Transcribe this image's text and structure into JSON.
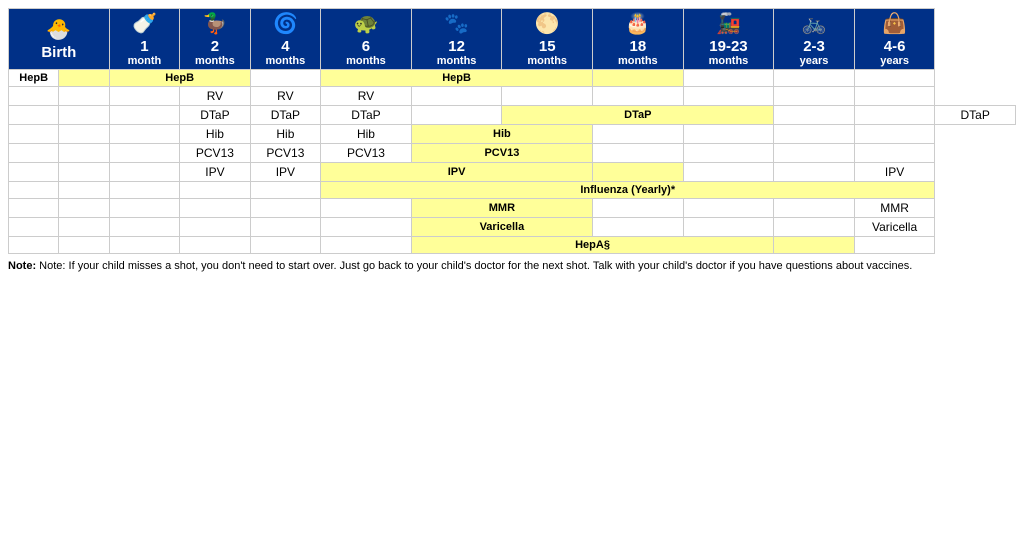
{
  "header": {
    "columns": [
      {
        "id": "birth",
        "icon": "🐣",
        "line1": "Birth",
        "line2": ""
      },
      {
        "id": "1m",
        "icon": "🍼",
        "line1": "1",
        "line2": "month"
      },
      {
        "id": "2m",
        "icon": "🦆",
        "line1": "2",
        "line2": "months"
      },
      {
        "id": "4m",
        "icon": "🌀",
        "line1": "4",
        "line2": "months"
      },
      {
        "id": "6m",
        "icon": "🐢",
        "line1": "6",
        "line2": "months"
      },
      {
        "id": "12m",
        "icon": "🐾",
        "line1": "12",
        "line2": "months"
      },
      {
        "id": "15m",
        "icon": "🌕",
        "line1": "15",
        "line2": "months"
      },
      {
        "id": "18m",
        "icon": "🎂",
        "line1": "18",
        "line2": "months"
      },
      {
        "id": "19m",
        "icon": "🚂",
        "line1": "19-23",
        "line2": "months"
      },
      {
        "id": "23y",
        "icon": "🚲",
        "line1": "2-3",
        "line2": "years"
      },
      {
        "id": "46y",
        "icon": "👜",
        "line1": "4-6",
        "line2": "years"
      }
    ]
  },
  "rows": [
    {
      "vaccine": "HepB",
      "cells": [
        {
          "id": "birth",
          "type": "yellow",
          "text": ""
        },
        {
          "id": "1m",
          "type": "yellow",
          "text": "HepB",
          "colspan": 2
        },
        {
          "id": "2m",
          "type": "skip"
        },
        {
          "id": "4m",
          "type": "empty",
          "text": ""
        },
        {
          "id": "6m",
          "type": "yellow",
          "text": "HepB",
          "colspan": 3
        },
        {
          "id": "12m",
          "type": "skip"
        },
        {
          "id": "15m",
          "type": "skip"
        },
        {
          "id": "18m",
          "type": "yellow",
          "text": ""
        },
        {
          "id": "19m",
          "type": "empty",
          "text": ""
        },
        {
          "id": "23y",
          "type": "empty",
          "text": ""
        },
        {
          "id": "46y",
          "type": "empty",
          "text": ""
        }
      ]
    },
    {
      "vaccine": "",
      "cells": [
        {
          "id": "birth",
          "type": "empty"
        },
        {
          "id": "1m",
          "type": "empty"
        },
        {
          "id": "2m",
          "type": "text",
          "text": "RV"
        },
        {
          "id": "4m",
          "type": "text",
          "text": "RV"
        },
        {
          "id": "6m",
          "type": "text",
          "text": "RV"
        },
        {
          "id": "12m",
          "type": "empty"
        },
        {
          "id": "15m",
          "type": "empty"
        },
        {
          "id": "18m",
          "type": "empty"
        },
        {
          "id": "19m",
          "type": "empty"
        },
        {
          "id": "23y",
          "type": "empty"
        },
        {
          "id": "46y",
          "type": "empty"
        }
      ]
    },
    {
      "vaccine": "",
      "cells": [
        {
          "id": "birth",
          "type": "empty"
        },
        {
          "id": "1m",
          "type": "empty"
        },
        {
          "id": "2m",
          "type": "text",
          "text": "DTaP"
        },
        {
          "id": "4m",
          "type": "text",
          "text": "DTaP"
        },
        {
          "id": "6m",
          "type": "text",
          "text": "DTaP"
        },
        {
          "id": "12m",
          "type": "empty"
        },
        {
          "id": "15m",
          "type": "yellow",
          "text": "DTaP",
          "colspan": 3
        },
        {
          "id": "18m",
          "type": "skip"
        },
        {
          "id": "19m",
          "type": "skip"
        },
        {
          "id": "23y",
          "type": "empty"
        },
        {
          "id": "46y",
          "type": "text",
          "text": "DTaP"
        }
      ]
    },
    {
      "vaccine": "",
      "cells": [
        {
          "id": "birth",
          "type": "empty"
        },
        {
          "id": "1m",
          "type": "empty"
        },
        {
          "id": "2m",
          "type": "text",
          "text": "Hib"
        },
        {
          "id": "4m",
          "type": "text",
          "text": "Hib"
        },
        {
          "id": "6m",
          "type": "text",
          "text": "Hib"
        },
        {
          "id": "12m",
          "type": "yellow",
          "text": "Hib",
          "colspan": 2
        },
        {
          "id": "15m",
          "type": "skip"
        },
        {
          "id": "18m",
          "type": "empty"
        },
        {
          "id": "19m",
          "type": "empty"
        },
        {
          "id": "23y",
          "type": "empty"
        },
        {
          "id": "46y",
          "type": "empty"
        }
      ]
    },
    {
      "vaccine": "",
      "cells": [
        {
          "id": "birth",
          "type": "empty"
        },
        {
          "id": "1m",
          "type": "empty"
        },
        {
          "id": "2m",
          "type": "text",
          "text": "PCV13"
        },
        {
          "id": "4m",
          "type": "text",
          "text": "PCV13"
        },
        {
          "id": "6m",
          "type": "text",
          "text": "PCV13"
        },
        {
          "id": "12m",
          "type": "yellow",
          "text": "PCV13",
          "colspan": 2
        },
        {
          "id": "15m",
          "type": "skip"
        },
        {
          "id": "18m",
          "type": "empty"
        },
        {
          "id": "19m",
          "type": "empty"
        },
        {
          "id": "23y",
          "type": "empty"
        },
        {
          "id": "46y",
          "type": "empty"
        }
      ]
    },
    {
      "vaccine": "",
      "cells": [
        {
          "id": "birth",
          "type": "empty"
        },
        {
          "id": "1m",
          "type": "empty"
        },
        {
          "id": "2m",
          "type": "text",
          "text": "IPV"
        },
        {
          "id": "4m",
          "type": "text",
          "text": "IPV"
        },
        {
          "id": "6m",
          "type": "yellow",
          "text": "IPV",
          "colspan": 3
        },
        {
          "id": "12m",
          "type": "skip"
        },
        {
          "id": "15m",
          "type": "skip"
        },
        {
          "id": "18m",
          "type": "yellow",
          "text": ""
        },
        {
          "id": "19m",
          "type": "empty"
        },
        {
          "id": "23y",
          "type": "empty"
        },
        {
          "id": "46y",
          "type": "text",
          "text": "IPV"
        }
      ]
    },
    {
      "vaccine": "",
      "cells": [
        {
          "id": "birth",
          "type": "empty"
        },
        {
          "id": "1m",
          "type": "empty"
        },
        {
          "id": "2m",
          "type": "empty"
        },
        {
          "id": "4m",
          "type": "empty"
        },
        {
          "id": "6m",
          "type": "yellow",
          "text": "Influenza (Yearly)*",
          "colspan": 7
        },
        {
          "id": "12m",
          "type": "skip"
        },
        {
          "id": "15m",
          "type": "skip"
        },
        {
          "id": "18m",
          "type": "skip"
        },
        {
          "id": "19m",
          "type": "skip"
        },
        {
          "id": "23y",
          "type": "skip"
        },
        {
          "id": "46y",
          "type": "skip"
        }
      ]
    },
    {
      "vaccine": "",
      "cells": [
        {
          "id": "birth",
          "type": "empty"
        },
        {
          "id": "1m",
          "type": "empty"
        },
        {
          "id": "2m",
          "type": "empty"
        },
        {
          "id": "4m",
          "type": "empty"
        },
        {
          "id": "6m",
          "type": "empty"
        },
        {
          "id": "12m",
          "type": "yellow",
          "text": "MMR",
          "colspan": 2
        },
        {
          "id": "15m",
          "type": "skip"
        },
        {
          "id": "18m",
          "type": "empty"
        },
        {
          "id": "19m",
          "type": "empty"
        },
        {
          "id": "23y",
          "type": "empty"
        },
        {
          "id": "46y",
          "type": "text",
          "text": "MMR"
        }
      ]
    },
    {
      "vaccine": "",
      "cells": [
        {
          "id": "birth",
          "type": "empty"
        },
        {
          "id": "1m",
          "type": "empty"
        },
        {
          "id": "2m",
          "type": "empty"
        },
        {
          "id": "4m",
          "type": "empty"
        },
        {
          "id": "6m",
          "type": "empty"
        },
        {
          "id": "12m",
          "type": "yellow",
          "text": "Varicella",
          "colspan": 2
        },
        {
          "id": "15m",
          "type": "skip"
        },
        {
          "id": "18m",
          "type": "empty"
        },
        {
          "id": "19m",
          "type": "empty"
        },
        {
          "id": "23y",
          "type": "empty"
        },
        {
          "id": "46y",
          "type": "text",
          "text": "Varicella"
        }
      ]
    },
    {
      "vaccine": "",
      "cells": [
        {
          "id": "birth",
          "type": "empty"
        },
        {
          "id": "1m",
          "type": "empty"
        },
        {
          "id": "2m",
          "type": "empty"
        },
        {
          "id": "4m",
          "type": "empty"
        },
        {
          "id": "6m",
          "type": "empty"
        },
        {
          "id": "12m",
          "type": "yellow",
          "text": "HepA§",
          "colspan": 4
        },
        {
          "id": "15m",
          "type": "skip"
        },
        {
          "id": "18m",
          "type": "skip"
        },
        {
          "id": "19m",
          "type": "skip"
        },
        {
          "id": "23y",
          "type": "yellow",
          "text": ""
        },
        {
          "id": "46y",
          "type": "empty"
        }
      ]
    }
  ],
  "vaccine_labels": [
    "HepB",
    "",
    "",
    "",
    "",
    "",
    "",
    "",
    "",
    ""
  ],
  "note": "Note: If your child misses a shot, you don't need to start over. Just go back to your child's doctor for the next shot. Talk with your child's doctor if you have questions about vaccines."
}
